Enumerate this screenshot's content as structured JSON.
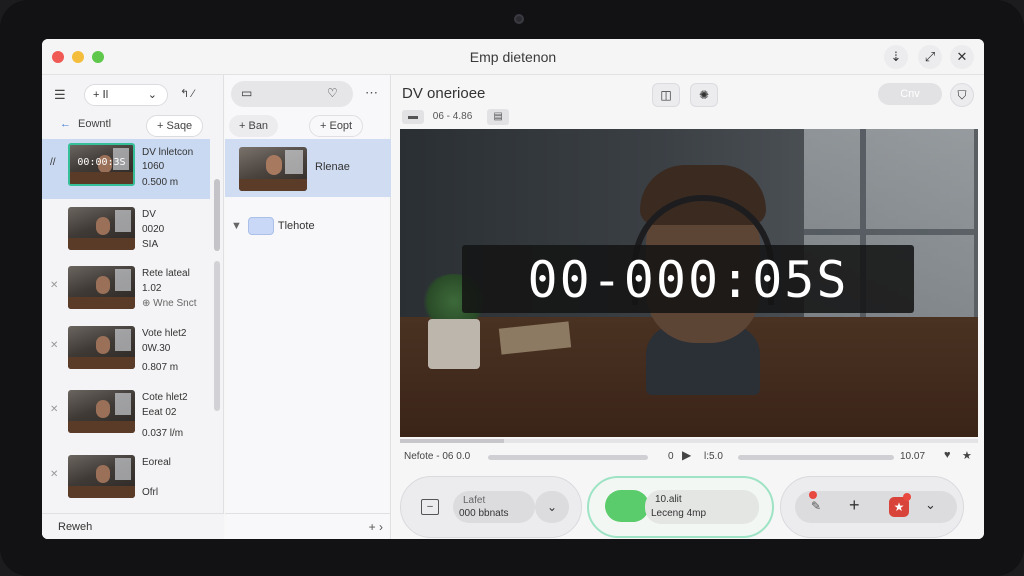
{
  "window": {
    "title": "Emp dietenon",
    "buttons": [
      "⇣",
      "⤢",
      "✕"
    ]
  },
  "sidebar": {
    "toolbar": {
      "menu_icon": "☰",
      "add_label": "+ ꓲl",
      "add_chevron": "⌄",
      "extra_icons": "↰ ⁄"
    },
    "tabs": {
      "back_label": "Eowntl",
      "search_label": "Saqe"
    },
    "clips": [
      {
        "timecode": "00:00:3S",
        "line1": "DV lnletcon",
        "line2": "1060",
        "line3": "0.500 m",
        "selected": true,
        "mark": "//"
      },
      {
        "line1": "DV",
        "line2": "0020",
        "line3": "SIA",
        "selected": false,
        "mark": ""
      },
      {
        "line1": "Rete lateal",
        "line2": "1.02",
        "line3": "⊕ Wne Snct",
        "selected": false,
        "mark": "✕"
      },
      {
        "line1": "Vote hlet2",
        "line2": "0W.30",
        "line3": "0.807 m",
        "selected": false,
        "mark": "✕"
      },
      {
        "line1": "Cote hlet2",
        "line2": "Eeat 02",
        "line3": "0.037 l/m",
        "selected": false,
        "mark": "✕"
      },
      {
        "line1": "Eoreal",
        "line2": "",
        "line3": "Ofrl",
        "selected": false,
        "mark": "✕"
      }
    ],
    "footer": "Reweh"
  },
  "middle": {
    "tabs": {
      "left": "+ Ban",
      "right": "+ Eopt"
    },
    "items": [
      {
        "label": "Rlenae"
      }
    ],
    "folder": {
      "label": "Tlehote"
    },
    "footer": "+ ›"
  },
  "viewer": {
    "title": "DV onerioee",
    "sub_label": "06 - 4.86",
    "export_label": "Cnv",
    "timecode": "00-000:05S",
    "progress": 0.18,
    "transport": {
      "left": "Nefote - 06 0.0",
      "mid": "0",
      "play_icon": "▶",
      "mid_right": "l:5.0",
      "right": "10.07",
      "right_icon": "★"
    }
  },
  "dock": {
    "left": {
      "line1": "Lafet",
      "line2": "000 bbnats"
    },
    "record": {
      "line1": "10.alit",
      "line2": "Leceng 4mp"
    },
    "right": {
      "plus": "+",
      "chevron": "⌄"
    }
  },
  "colors": {
    "accent_green": "#5bcc6b",
    "selection_blue": "#c9d9f1",
    "record_red": "#d9443a"
  }
}
